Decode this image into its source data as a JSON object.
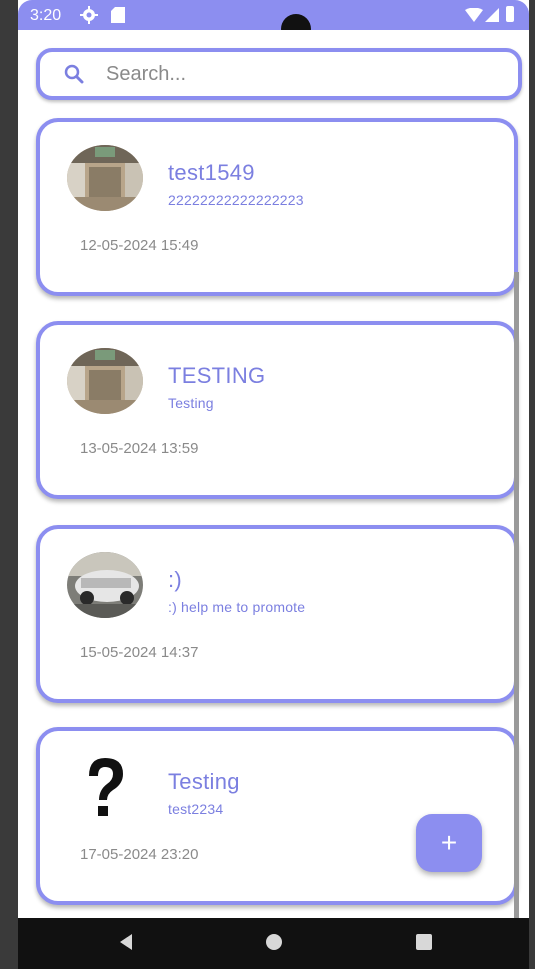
{
  "status_bar": {
    "time": "3:20",
    "icons": [
      "gear-icon",
      "sd-card-icon",
      "wifi-icon",
      "signal-icon",
      "battery-icon"
    ],
    "color": "#8c8ef0"
  },
  "search": {
    "placeholder": "Search...",
    "value": ""
  },
  "posts": [
    {
      "title": "test1549",
      "subtitle": "22222222222222223",
      "date": "12-05-2024 15:49",
      "avatar": "room-photo"
    },
    {
      "title": "TESTING",
      "subtitle": "Testing",
      "date": "13-05-2024 13:59",
      "avatar": "room-photo"
    },
    {
      "title": ":)",
      "subtitle": ":) help me to promote",
      "date": "15-05-2024 14:37",
      "avatar": "car-photo"
    },
    {
      "title": "Testing",
      "subtitle": "test2234",
      "date": "17-05-2024 23:20",
      "avatar": "question-mark"
    }
  ],
  "fab": {
    "label": "+"
  },
  "nav": {
    "icons": [
      "back-icon",
      "home-icon",
      "recents-icon"
    ]
  },
  "colors": {
    "accent": "#8c8ef0",
    "text_accent": "#7b7fe0",
    "date_text": "#8a8a8a"
  }
}
